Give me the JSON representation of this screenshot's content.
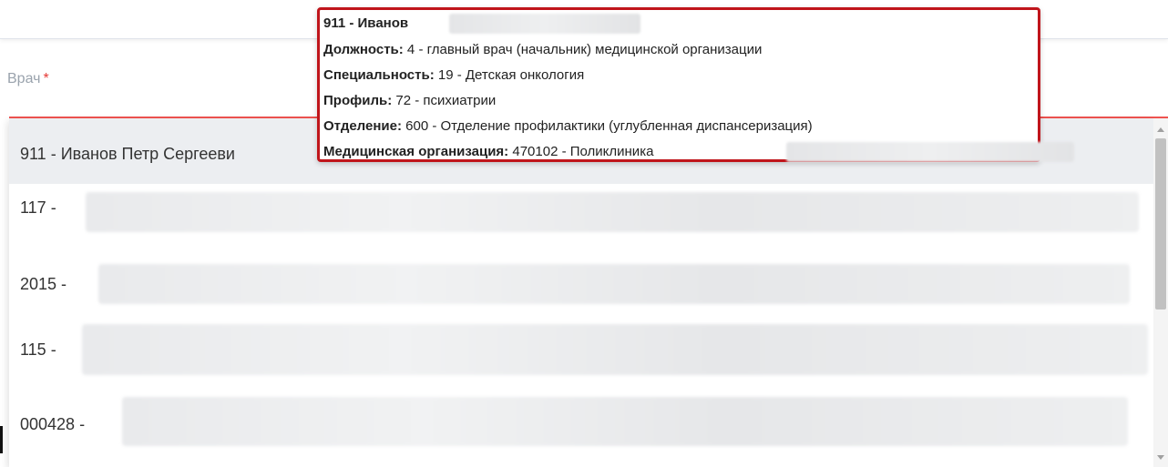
{
  "field": {
    "label": "Врач",
    "required_mark": "*"
  },
  "options": [
    {
      "code": "911 - Иванов Петр Сергееви",
      "selected": true
    },
    {
      "code": "117 -",
      "selected": false
    },
    {
      "code": "2015 -",
      "selected": false
    },
    {
      "code": "115 -",
      "selected": false
    },
    {
      "code": "000428 -",
      "selected": false
    }
  ],
  "tooltip": {
    "title": "911 - Иванов",
    "position_label": "Должность:",
    "position_value": " 4 - главный врач (начальник) медицинской организации",
    "specialty_label": "Специальность:",
    "specialty_value": " 19 - Детская онкология",
    "profile_label": "Профиль:",
    "profile_value": " 72 - психиатрии",
    "department_label": "Отделение:",
    "department_value": " 600 - Отделение профилактики (углубленная диспансеризация)",
    "org_label": "Медицинская организация:",
    "org_value": " 470102 - Поликлиника"
  },
  "colors": {
    "accent_error": "#ef5350",
    "tooltip_border": "#c0151b",
    "selected_bg": "#eceef1"
  },
  "icons": {
    "scroll_up": "triangle-up",
    "scroll_down": "triangle-down"
  }
}
